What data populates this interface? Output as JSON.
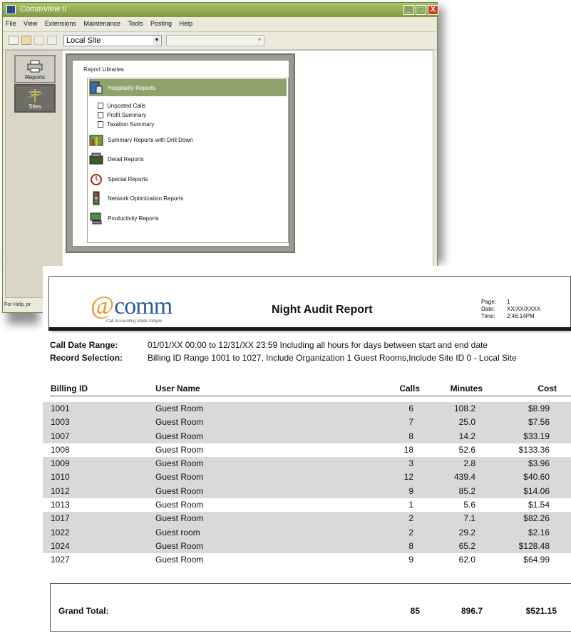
{
  "window": {
    "title": "CommView II",
    "min_glyph": "_",
    "max_glyph": "□",
    "close_glyph": "X"
  },
  "menu": [
    "File",
    "View",
    "Extensions",
    "Maintenance",
    "Tools",
    "Posting",
    "Help"
  ],
  "toolbar": {
    "site_value": "Local Site",
    "second_value": "",
    "arrow": "▼"
  },
  "nav": {
    "reports_label": "Reports",
    "sites_label": "Sites"
  },
  "libraries": {
    "title": "Report Libraries",
    "items": [
      "Hospitality Reports",
      "Summary Reports with Drill Down",
      "Detail Reports",
      "Special Reports",
      "Network Optimization Reports",
      "Productivity Reports"
    ],
    "children": [
      "Unposted Calls",
      "Profit Summary",
      "Taxation Summary"
    ]
  },
  "status_text": "For Help, pr",
  "report": {
    "logo_at": "@",
    "logo_word": "comm",
    "logo_tagline": "Call Accounting Made Simple",
    "title": "Night Audit Report",
    "page_label": "Page:",
    "page_value": "1",
    "date_label": "Date:",
    "date_value": "XX/XX/XXXX",
    "time_label": "Time:",
    "time_value": "2:46:14PM",
    "call_date_label": "Call Date Range:",
    "call_date_value": "01/01/XX  00:00 to 12/31/XX  23:59  Including all hours for days between start and end date",
    "record_label": "Record Selection:",
    "record_value": "Billing ID Range 1001 to 1027, Include Organization 1 Guest Rooms,Include Site ID 0 - Local Site",
    "columns": [
      "Billing ID",
      "User Name",
      "Calls",
      "Minutes",
      "Cost"
    ],
    "rows": [
      {
        "id": "1001",
        "user": "Guest Room",
        "calls": "6",
        "minutes": "108.2",
        "cost": "$8.99",
        "shade": true
      },
      {
        "id": "1003",
        "user": "Guest Room",
        "calls": "7",
        "minutes": "25.0",
        "cost": "$7.56",
        "shade": true
      },
      {
        "id": "1007",
        "user": "Guest Room",
        "calls": "8",
        "minutes": "14.2",
        "cost": "$33.19",
        "shade": true
      },
      {
        "id": "1008",
        "user": "Guest Room",
        "calls": "18",
        "minutes": "52.6",
        "cost": "$133.36",
        "shade": false
      },
      {
        "id": "1009",
        "user": "Guest Room",
        "calls": "3",
        "minutes": "2.8",
        "cost": "$3.96",
        "shade": true
      },
      {
        "id": "1010",
        "user": "Guest Room",
        "calls": "12",
        "minutes": "439.4",
        "cost": "$40.60",
        "shade": true
      },
      {
        "id": "1012",
        "user": "Guest Room",
        "calls": "9",
        "minutes": "85.2",
        "cost": "$14.06",
        "shade": true
      },
      {
        "id": "1013",
        "user": "Guest Room",
        "calls": "1",
        "minutes": "5.6",
        "cost": "$1.54",
        "shade": false
      },
      {
        "id": "1017",
        "user": "Guest Room",
        "calls": "2",
        "minutes": "7.1",
        "cost": "$82.26",
        "shade": true
      },
      {
        "id": "1022",
        "user": "Guest room",
        "calls": "2",
        "minutes": "29.2",
        "cost": "$2.16",
        "shade": true
      },
      {
        "id": "1024",
        "user": "Guest Room",
        "calls": "8",
        "minutes": "65.2",
        "cost": "$128.48",
        "shade": true
      },
      {
        "id": "1027",
        "user": "Guest Room",
        "calls": "9",
        "minutes": "62.0",
        "cost": "$64.99",
        "shade": false
      }
    ],
    "total_label": "Grand Total:",
    "total_calls": "85",
    "total_minutes": "896.7",
    "total_cost": "$521.15"
  }
}
